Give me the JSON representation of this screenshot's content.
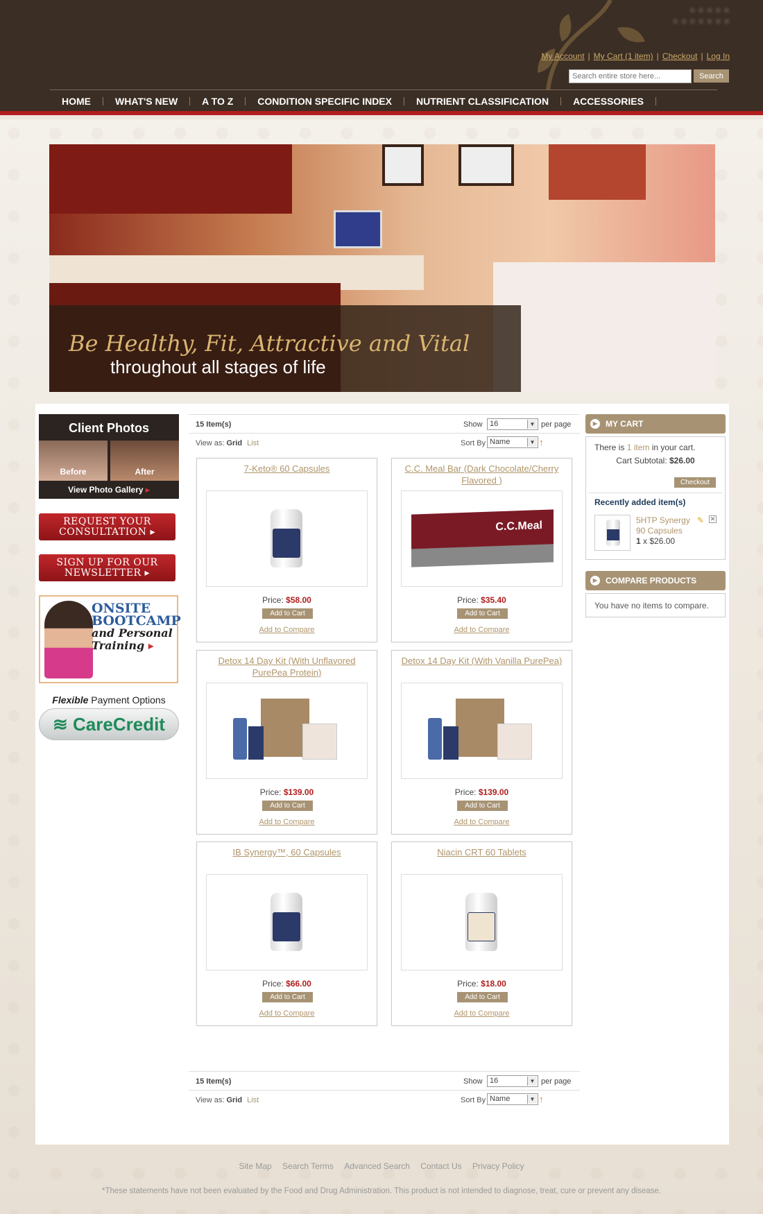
{
  "header": {
    "links": [
      "My Account",
      "My Cart (1 item)",
      "Checkout",
      "Log In"
    ],
    "search_placeholder": "Search entire store here...",
    "search_button": "Search",
    "nav": [
      "HOME",
      "WHAT'S NEW",
      "A TO Z",
      "CONDITION SPECIFIC INDEX",
      "NUTRIENT CLASSIFICATION",
      "ACCESSORIES"
    ]
  },
  "hero": {
    "tagline_1": "Be Healthy, Fit, Attractive and Vital",
    "tagline_2": "throughout all stages of life"
  },
  "sidebar_left": {
    "client_photos_title": "Client Photos",
    "before_label": "Before",
    "after_label": "After",
    "gallery_link": "View Photo Gallery",
    "consult_button": "REQUEST YOUR CONSULTATION",
    "newsletter_button": "SIGN UP FOR OUR NEWSLETTER",
    "bootcamp_1": "ONSITE BOOTCAMP",
    "bootcamp_2": "and Personal Training",
    "flexible": "Flexible",
    "payment_options": " Payment Options",
    "carecredit": "CareCredit"
  },
  "toolbar": {
    "item_count": "15 Item(s)",
    "show_label": "Show",
    "show_value": "16",
    "per_page": "per page",
    "view_as": "View as:",
    "grid": "Grid",
    "list": "List",
    "sort_by": "Sort By",
    "sort_value": "Name",
    "sort_arrow": "↑"
  },
  "products": [
    {
      "name": "7-Keto® 60 Capsules",
      "price_label": "Price:",
      "price": "$58.00",
      "add_to_cart": "Add to Cart",
      "add_to_compare": "Add to Compare"
    },
    {
      "name": "C.C. Meal Bar (Dark Chocolate/Cherry Flavored )",
      "price_label": "Price:",
      "price": "$35.40",
      "add_to_cart": "Add to Cart",
      "add_to_compare": "Add to Compare",
      "image_text": "C.C.Meal"
    },
    {
      "name": "Detox 14 Day Kit (With Unflavored PurePea Protein)",
      "price_label": "Price:",
      "price": "$139.00",
      "add_to_cart": "Add to Cart",
      "add_to_compare": "Add to Compare"
    },
    {
      "name": "Detox 14 Day Kit (With Vanilla PurePea)",
      "price_label": "Price:",
      "price": "$139.00",
      "add_to_cart": "Add to Cart",
      "add_to_compare": "Add to Compare"
    },
    {
      "name": "IB Synergy™, 60 Capsules",
      "price_label": "Price:",
      "price": "$66.00",
      "add_to_cart": "Add to Cart",
      "add_to_compare": "Add to Compare"
    },
    {
      "name": "Niacin CRT 60 Tablets",
      "price_label": "Price:",
      "price": "$18.00",
      "add_to_cart": "Add to Cart",
      "add_to_compare": "Add to Compare"
    }
  ],
  "cart": {
    "title": "MY CART",
    "line_prefix": "There is ",
    "line_count": "1 item",
    "line_suffix": " in your cart.",
    "subtotal_label": "Cart Subtotal: ",
    "subtotal": "$26.00",
    "checkout": "Checkout",
    "recent_title": "Recently added item(s)",
    "recent_name": "5HTP Synergy 90 Capsules",
    "recent_qty": "1",
    "recent_price": " x $26.00"
  },
  "compare": {
    "title": "COMPARE PRODUCTS",
    "empty": "You have no items to compare."
  },
  "footer": {
    "links": [
      "Site Map",
      "Search Terms",
      "Advanced Search",
      "Contact Us",
      "Privacy Policy"
    ],
    "disclaimer": "*These statements have not been evaluated by the Food and Drug Administration. This product is not intended to diagnose, treat, cure or prevent any disease."
  }
}
